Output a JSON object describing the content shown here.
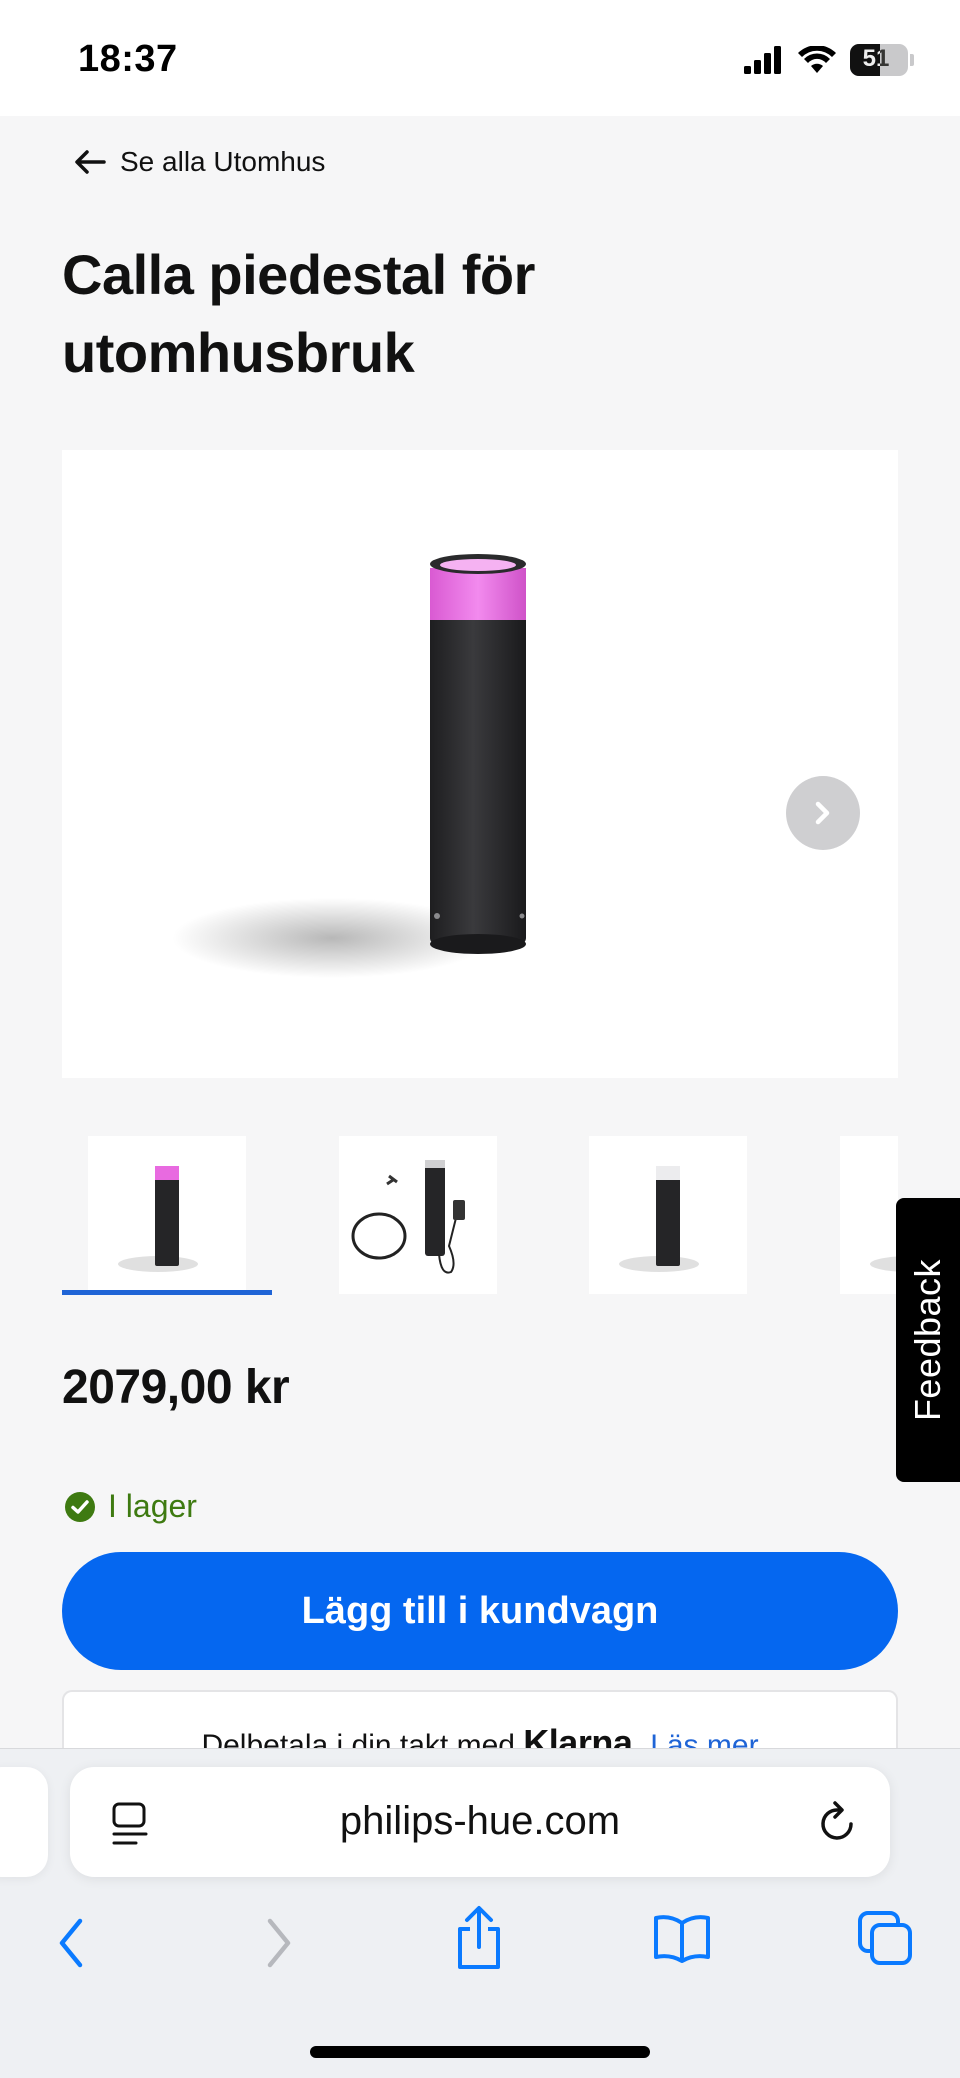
{
  "status_bar": {
    "time": "18:37",
    "battery_level": "51"
  },
  "nav": {
    "back_label": "Se alla Utomhus"
  },
  "product": {
    "title": "Calla piedestal för utomhusbruk",
    "price": "2079,00 kr",
    "stock_status": "I lager",
    "add_to_cart_label": "Lägg till i kundvagn",
    "gallery": {
      "selected_index": 0,
      "thumbnail_count_visible": 4
    }
  },
  "klarna": {
    "text": "Delbetala i din takt med",
    "logo": "Klarna.",
    "link_label": "Läs mer"
  },
  "feedback_label": "Feedback",
  "browser": {
    "url": "philips-hue.com"
  },
  "colors": {
    "accent_blue": "#0567f0",
    "underline_blue": "#1f64d6",
    "in_stock_green": "#3e7a11",
    "lamp_pink": "#e86ae0",
    "lamp_body": "#2a2a2c"
  }
}
